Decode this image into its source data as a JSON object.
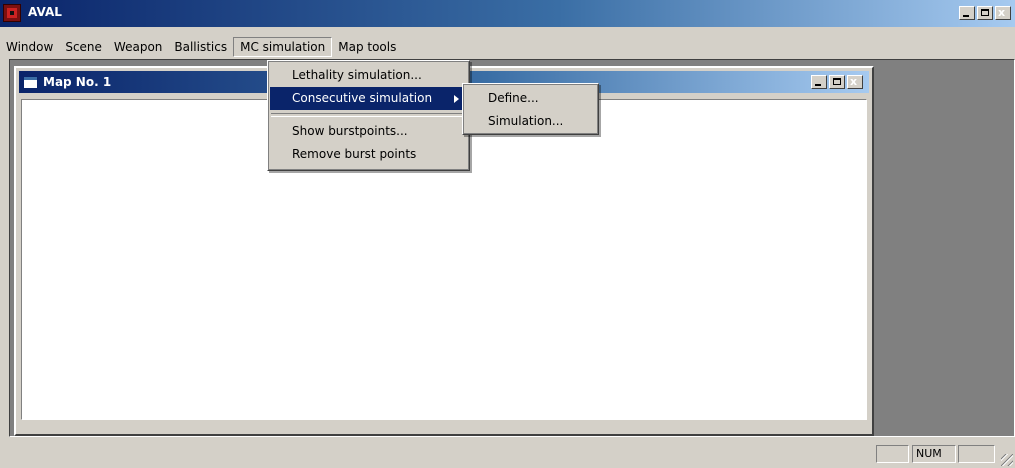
{
  "app": {
    "title": "AVAL",
    "title_gradient": [
      "#0a246a",
      "#a6caf0"
    ],
    "icon": "aval-app-icon"
  },
  "title_controls": {
    "min": "_",
    "max": "□",
    "close": "x"
  },
  "menubar": {
    "items": [
      {
        "label": "Window"
      },
      {
        "label": "Scene"
      },
      {
        "label": "Weapon"
      },
      {
        "label": "Ballistics"
      },
      {
        "label": "MC simulation",
        "open": true
      },
      {
        "label": "Map tools"
      }
    ]
  },
  "mc_simulation_menu": {
    "items": [
      {
        "label": "Lethality simulation..."
      },
      {
        "label": "Consecutive simulation",
        "highlighted": true,
        "has_submenu": true
      },
      {
        "label": "Show burstpoints..."
      },
      {
        "label": "Remove burst points"
      }
    ]
  },
  "consecutive_submenu": {
    "items": [
      {
        "label": "Define..."
      },
      {
        "label": "Simulation..."
      }
    ]
  },
  "child_window": {
    "title": "Map No. 1",
    "icon": "map-window-icon"
  },
  "statusbar": {
    "panes": [
      "",
      "NUM",
      ""
    ]
  },
  "colors": {
    "face": "#d4d0c8",
    "mdi_background": "#808080",
    "highlight": "#0a246a"
  }
}
